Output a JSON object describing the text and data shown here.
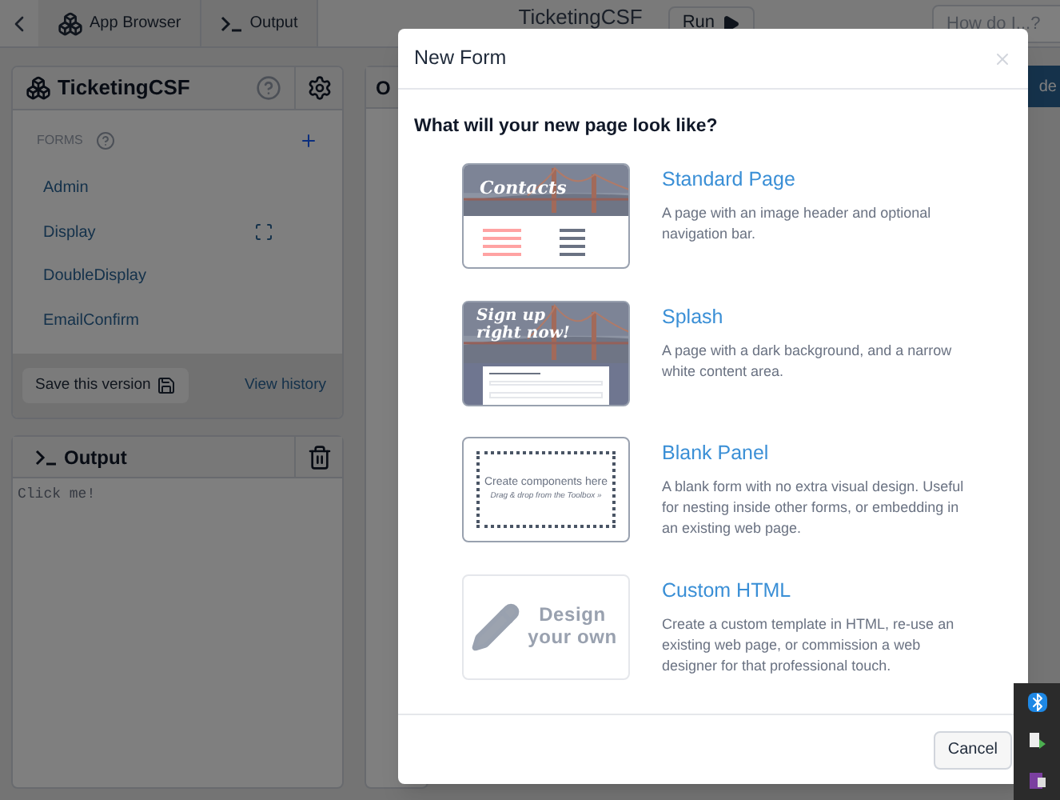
{
  "topbar": {
    "tabs": [
      {
        "label": "App Browser",
        "kind": "apps"
      },
      {
        "label": "Output",
        "kind": "terminal"
      }
    ],
    "title": "TicketingCSF",
    "run_button": "Run",
    "search": {
      "placeholder": "How do I...?"
    }
  },
  "app_panel": {
    "title": "TicketingCSF",
    "section": "FORMS",
    "items": [
      {
        "label": "Admin",
        "kind": "plain"
      },
      {
        "label": "Display",
        "kind": "designer"
      },
      {
        "label": "DoubleDisplay",
        "kind": "plain"
      },
      {
        "label": "EmailConfirm",
        "kind": "plain"
      }
    ],
    "save_button": "Save this version",
    "history_link": "View history"
  },
  "output_panel": {
    "title": "Output",
    "text": "Click me!"
  },
  "center_panel": {
    "title": "O"
  },
  "right_button": "de",
  "dialog": {
    "title": "New Form",
    "question": "What will your new page look like?",
    "options": [
      {
        "kind": "standard",
        "title": "Standard Page",
        "description": "A page with an image header and optional navigation bar.",
        "preview_text": "Contacts"
      },
      {
        "kind": "splash",
        "title": "Splash",
        "description": "A page with a dark background, and a narrow white content area.",
        "preview_text": "Sign up right now!"
      },
      {
        "kind": "blank",
        "title": "Blank Panel",
        "description": "A blank form with no extra visual design. Useful for nesting inside other forms, or embedding in an existing web page.",
        "preview_text": "Create components here",
        "preview_hint": "Drag & drop from the Toolbox »"
      },
      {
        "kind": "custom",
        "title": "Custom HTML",
        "description": "Create a custom template in HTML, re-use an existing web page, or commission a web designer for that professional touch.",
        "preview_text": "Design your own"
      }
    ],
    "cancel_button": "Cancel"
  }
}
